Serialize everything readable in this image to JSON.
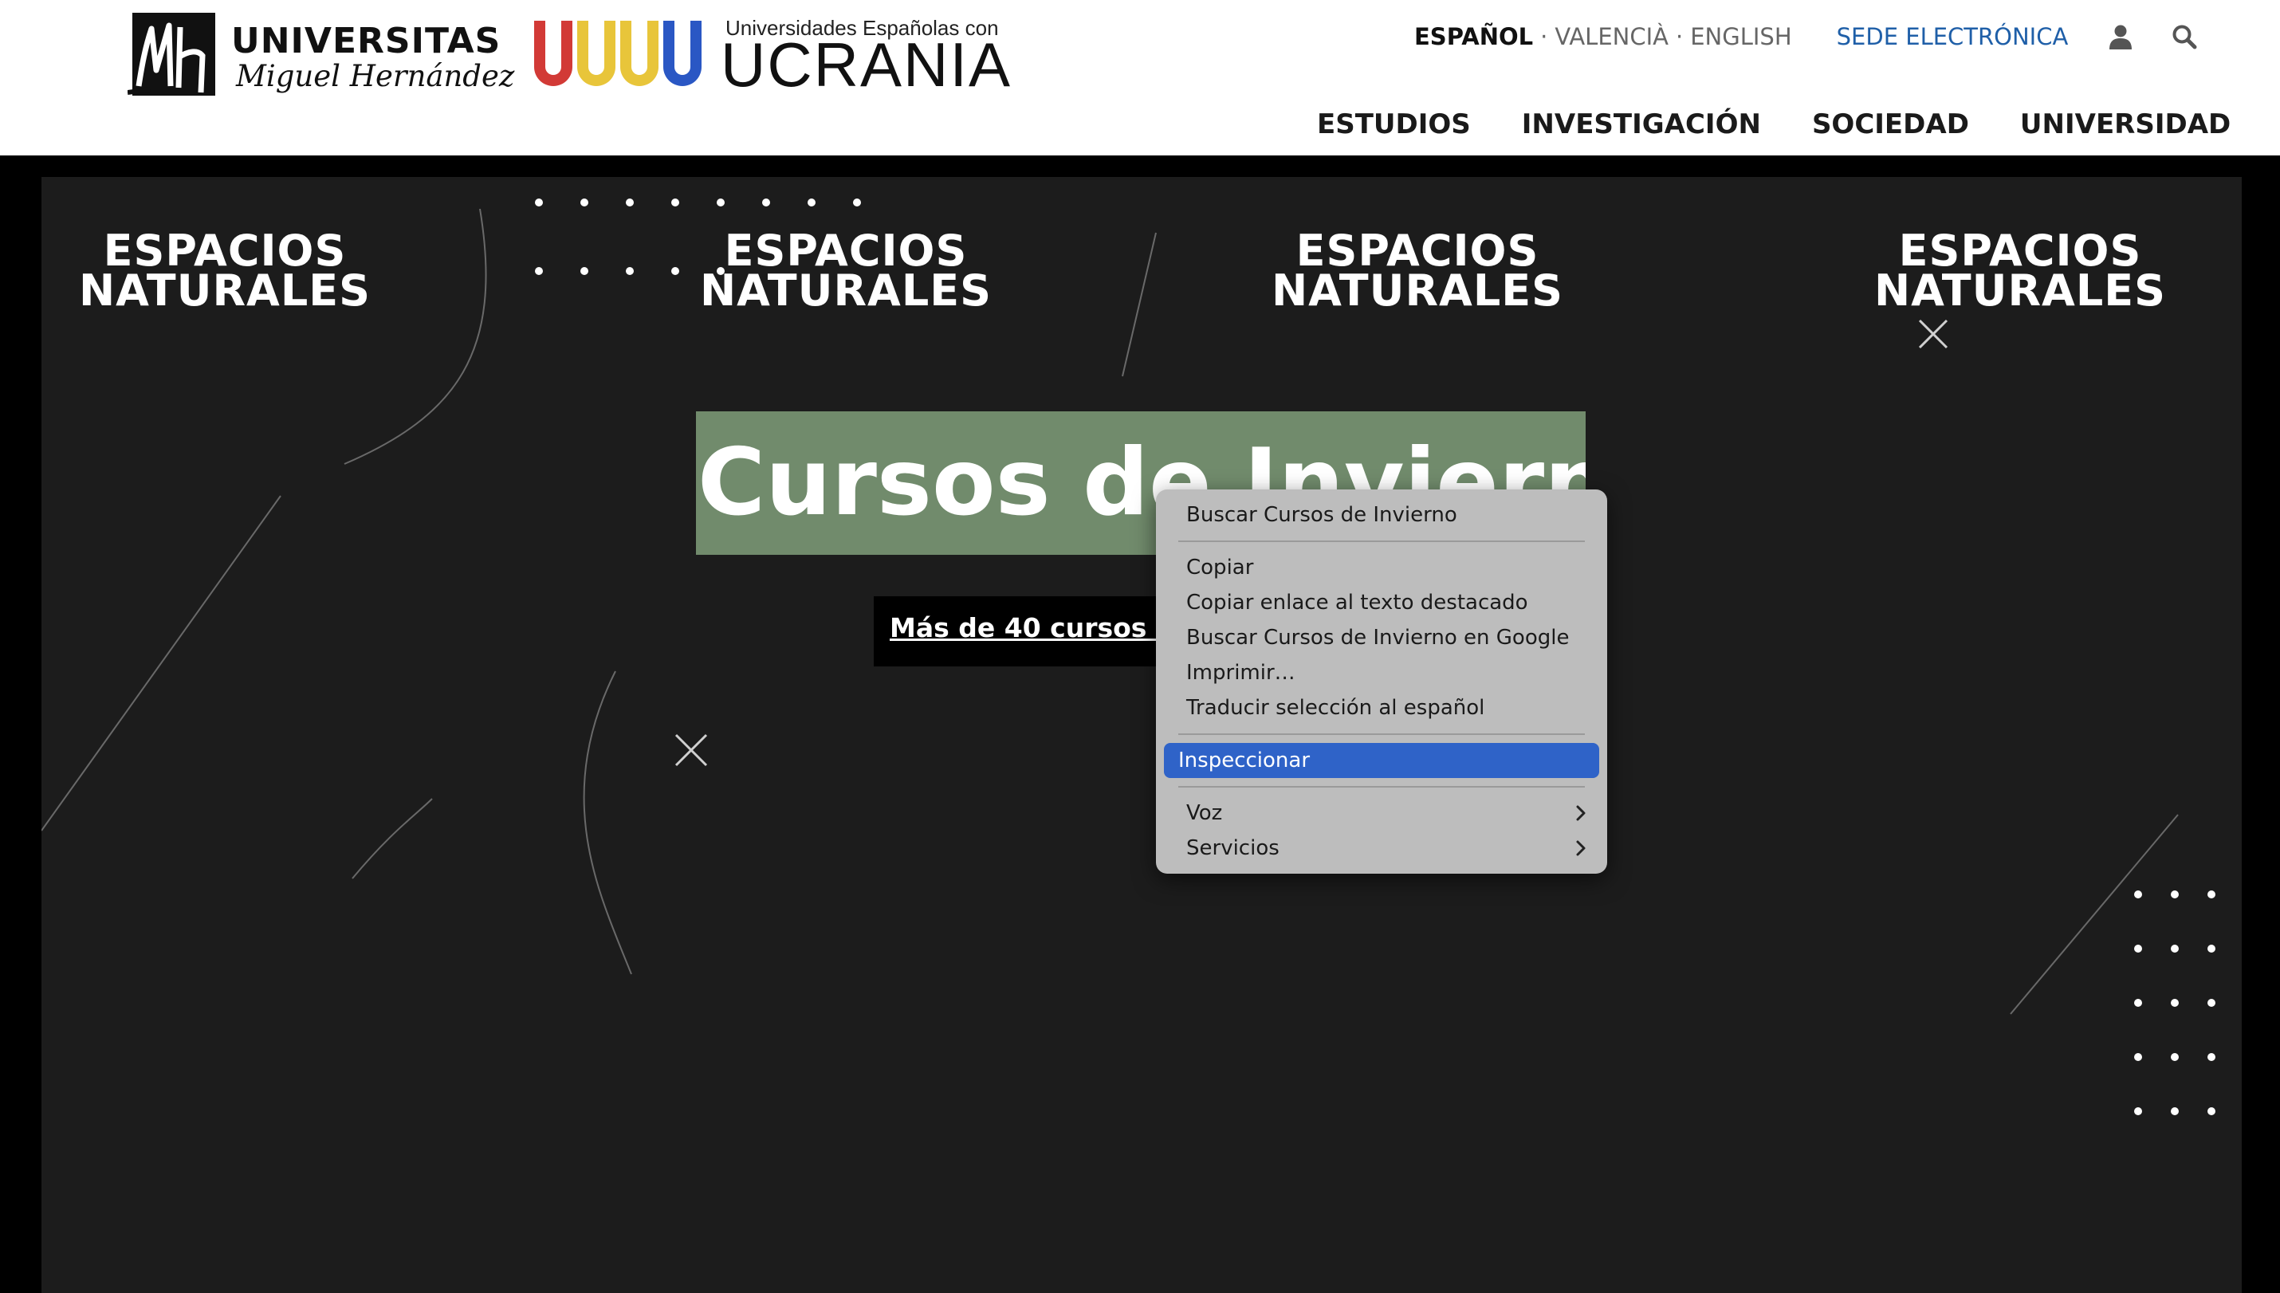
{
  "header": {
    "umh_logo": {
      "word": "UNIVERSITAS",
      "name": "Miguel Hernández"
    },
    "ucrania_logo": {
      "subtitle": "Universidades Españolas con",
      "title": "UCRANIA",
      "bar_colors": [
        "#d23a36",
        "#e8c53a",
        "#e8c53a",
        "#2a57c4"
      ]
    },
    "languages": [
      "ESPAÑOL",
      "VALENCIÀ",
      "ENGLISH"
    ],
    "active_language": "ESPAÑOL",
    "language_separator": "·",
    "sede": "SEDE ELECTRÓNICA",
    "icons": {
      "user": "user-icon",
      "search": "search-icon"
    },
    "nav": [
      "ESTUDIOS",
      "INVESTIGACIÓN",
      "SOCIEDAD",
      "UNIVERSIDAD"
    ]
  },
  "hero": {
    "banners": [
      {
        "line1": "ESPACIOS",
        "line2": "NATURALES"
      },
      {
        "line1": "ESPACIOS",
        "line2": "NATURALES"
      },
      {
        "line1": "ESPACIOS",
        "line2": "NATURALES"
      },
      {
        "line1": "ESPACIOS",
        "line2": "NATURALES"
      }
    ],
    "title": "Cursos de Invierno",
    "subtitle": "Más de 40 cursos te esperan"
  },
  "context_menu": {
    "items": [
      {
        "label": "Buscar Cursos de Invierno"
      },
      {
        "separator": true
      },
      {
        "label": "Copiar"
      },
      {
        "label": "Copiar enlace al texto destacado"
      },
      {
        "label": "Buscar Cursos de Invierno en Google"
      },
      {
        "label": "Imprimir…"
      },
      {
        "label": "Traducir selección al español"
      },
      {
        "separator": true
      },
      {
        "label": "Inspeccionar",
        "highlighted": true
      },
      {
        "separator": true
      },
      {
        "label": "Voz",
        "submenu": true
      },
      {
        "label": "Servicios",
        "submenu": true
      }
    ]
  },
  "colors": {
    "link_blue": "#1f5fa8",
    "hero_bg": "#1c1c1c",
    "title_highlight": "#718b6c",
    "menu_highlight": "#2f63c8"
  }
}
